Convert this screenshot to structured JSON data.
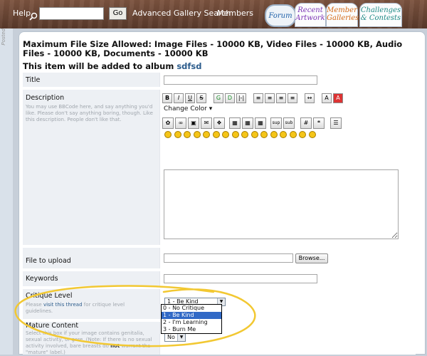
{
  "topbar": {
    "help_label": "Help",
    "search_value": "",
    "go_label": "Go",
    "advanced_search_label": "Advanced Gallery Search",
    "members_label": "Members"
  },
  "tabs": [
    {
      "line1": "Forum",
      "line2": "",
      "color": "#1d5fa8"
    },
    {
      "line1": "Recent",
      "line2": "Artwork",
      "color": "#7c35b5"
    },
    {
      "line1": "Member",
      "line2": "Galleries",
      "color": "#d36813"
    },
    {
      "line1": "Challenges",
      "line2": "& Contests",
      "color": "#1f8a85"
    }
  ],
  "side_text": "Posted",
  "info": {
    "max_file_size": "Maximum File Size Allowed: Image Files - 10000 KB, Video Files - 10000 KB, Audio Files - 10000 KB, Documents - 10000 KB",
    "album_prefix": "This item will be added to album",
    "album_name": "sdfsd"
  },
  "form": {
    "title": {
      "label": "Title",
      "value": ""
    },
    "description": {
      "label": "Description",
      "help": "You may use BBCode here, and say anything you'd like. Please don't say anything boring, though. Like this description. People don't like that.",
      "change_color_label": "Change Color",
      "value": ""
    },
    "file": {
      "label": "File to upload",
      "value": "",
      "browse_label": "Browse..."
    },
    "keywords": {
      "label": "Keywords",
      "value": ""
    },
    "critique": {
      "label": "Critique Level",
      "help_prefix": "Please",
      "help_link": "visit this thread",
      "help_suffix": "for critique level guidelines.",
      "selected": "1 - Be Kind",
      "options": [
        "0 - No Critique",
        "1 - Be Kind",
        "2 - I'm Learning",
        "3 - Burn Me"
      ],
      "highlighted_index": 1
    },
    "mature": {
      "label": "Mature Content",
      "help1": "Select this box if your image contains genitalia, sexual activity, or gore. (Note: If there is no sexual activity involved, bare breasts do",
      "help_not": "not",
      "help2": "warrant the \"mature\" label.)",
      "selected": "No"
    }
  },
  "toolbar_icons": {
    "row1": [
      {
        "name": "bold-icon",
        "glyph": "B"
      },
      {
        "name": "italic-icon",
        "glyph": "I"
      },
      {
        "name": "underline-icon",
        "glyph": "U"
      },
      {
        "name": "strikethrough-icon",
        "glyph": "S"
      },
      {
        "name": "glow-icon",
        "glyph": "G"
      },
      {
        "name": "shadow-icon",
        "glyph": "D"
      },
      {
        "name": "teletype-icon",
        "glyph": "|-|"
      },
      {
        "name": "align-left-icon",
        "glyph": "≡"
      },
      {
        "name": "align-center-icon",
        "glyph": "≡"
      },
      {
        "name": "align-justify-icon",
        "glyph": "≡"
      },
      {
        "name": "align-right-icon",
        "glyph": "≡"
      },
      {
        "name": "hr-icon",
        "glyph": "↔"
      },
      {
        "name": "font-size-icon",
        "glyph": "A"
      },
      {
        "name": "font-color-icon",
        "glyph": "A"
      }
    ],
    "row2": [
      {
        "name": "flash-icon",
        "glyph": "✿"
      },
      {
        "name": "link-icon",
        "glyph": "∞"
      },
      {
        "name": "image-icon",
        "glyph": "▣"
      },
      {
        "name": "email-icon",
        "glyph": "✉"
      },
      {
        "name": "ftp-icon",
        "glyph": "❖"
      },
      {
        "name": "table-icon",
        "glyph": "▦"
      },
      {
        "name": "table-row-icon",
        "glyph": "▦"
      },
      {
        "name": "table-cell-icon",
        "glyph": "▦"
      },
      {
        "name": "superscript-icon",
        "glyph": "sup"
      },
      {
        "name": "subscript-icon",
        "glyph": "sub"
      },
      {
        "name": "ordered-list-icon",
        "glyph": "#"
      },
      {
        "name": "quote-icon",
        "glyph": "❝"
      },
      {
        "name": "list-icon",
        "glyph": "☰"
      }
    ],
    "smiley_count": 16,
    "smiley_color": "#f5c518"
  },
  "colors": {
    "header_brown": "#6b4733",
    "link_blue": "#2c5c8c",
    "highlight_yellow": "#f2c832",
    "select_blue": "#3169c6"
  }
}
